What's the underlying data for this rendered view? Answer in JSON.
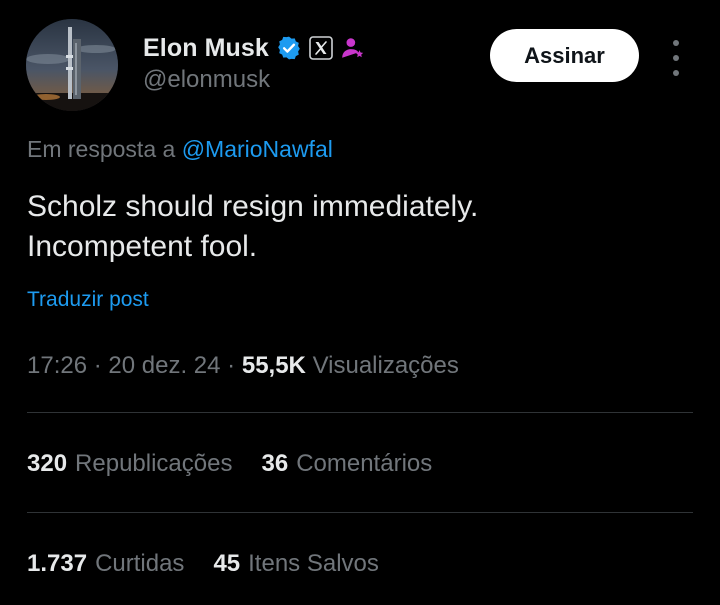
{
  "author": {
    "name": "Elon Musk",
    "handle": "@elonmusk",
    "icons": [
      "verified-badge-icon",
      "x-affiliate-icon",
      "parody-person-icon"
    ]
  },
  "follow_button": {
    "label": "Assinar"
  },
  "reply_context": {
    "prefix": "Em resposta a",
    "mention": "@MarioNawfal"
  },
  "post": {
    "line1": "Scholz should resign immediately.",
    "line2": "Incompetent fool.",
    "translate_label": "Traduzir post"
  },
  "meta": {
    "time": "17:26",
    "date": "20 dez. 24",
    "views_count": "55,5K",
    "views_label": "Visualizações"
  },
  "stats": {
    "reposts_count": "320",
    "reposts_label": "Republicações",
    "comments_count": "36",
    "comments_label": "Comentários",
    "likes_count": "1.737",
    "likes_label": "Curtidas",
    "bookmarks_count": "45",
    "bookmarks_label": "Itens Salvos"
  },
  "colors": {
    "background": "#000000",
    "text": "#e7e9ea",
    "muted": "#71767b",
    "link": "#1d9bf0",
    "divider": "#2f3336",
    "verified": "#1d9bf0",
    "parody": "#c936cc"
  }
}
